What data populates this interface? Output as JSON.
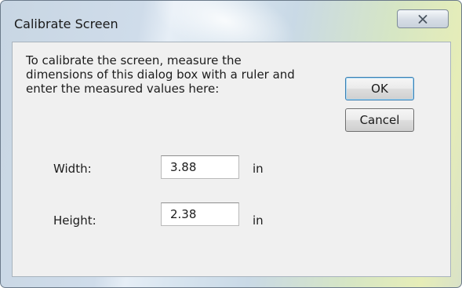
{
  "window": {
    "title": "Calibrate Screen"
  },
  "dialog": {
    "instructions": "To calibrate the screen, measure the\ndimensions of this dialog box with a ruler and\nenter the measured values here:",
    "ok_label": "OK",
    "cancel_label": "Cancel",
    "width": {
      "label": "Width:",
      "value": "3.88",
      "unit": "in"
    },
    "height": {
      "label": "Height:",
      "value": "2.38",
      "unit": "in"
    }
  },
  "icons": {
    "close": "close-icon"
  },
  "colors": {
    "ok_border": "#3c7fb1",
    "client_bg": "#f0f0f0"
  }
}
